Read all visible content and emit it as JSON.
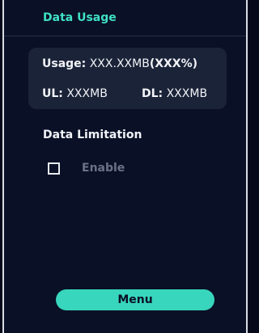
{
  "header": {
    "title": "Data Usage"
  },
  "usage": {
    "usage_label": "Usage:",
    "usage_value": " XXX.XXMB",
    "usage_percent": "(XXX%)",
    "ul_label": "UL:",
    "ul_value": " XXXMB",
    "dl_label": "DL:",
    "dl_value": " XXXMB"
  },
  "data_limitation": {
    "title": "Data Limitation",
    "enable_label": "Enable",
    "enable_checked": false
  },
  "footer": {
    "menu_label": "Menu"
  },
  "colors": {
    "accent": "#3fe0c5",
    "button": "#38d6bc",
    "background": "#0a1026",
    "card": "#1b2338",
    "disabled_text": "#6a7285"
  }
}
